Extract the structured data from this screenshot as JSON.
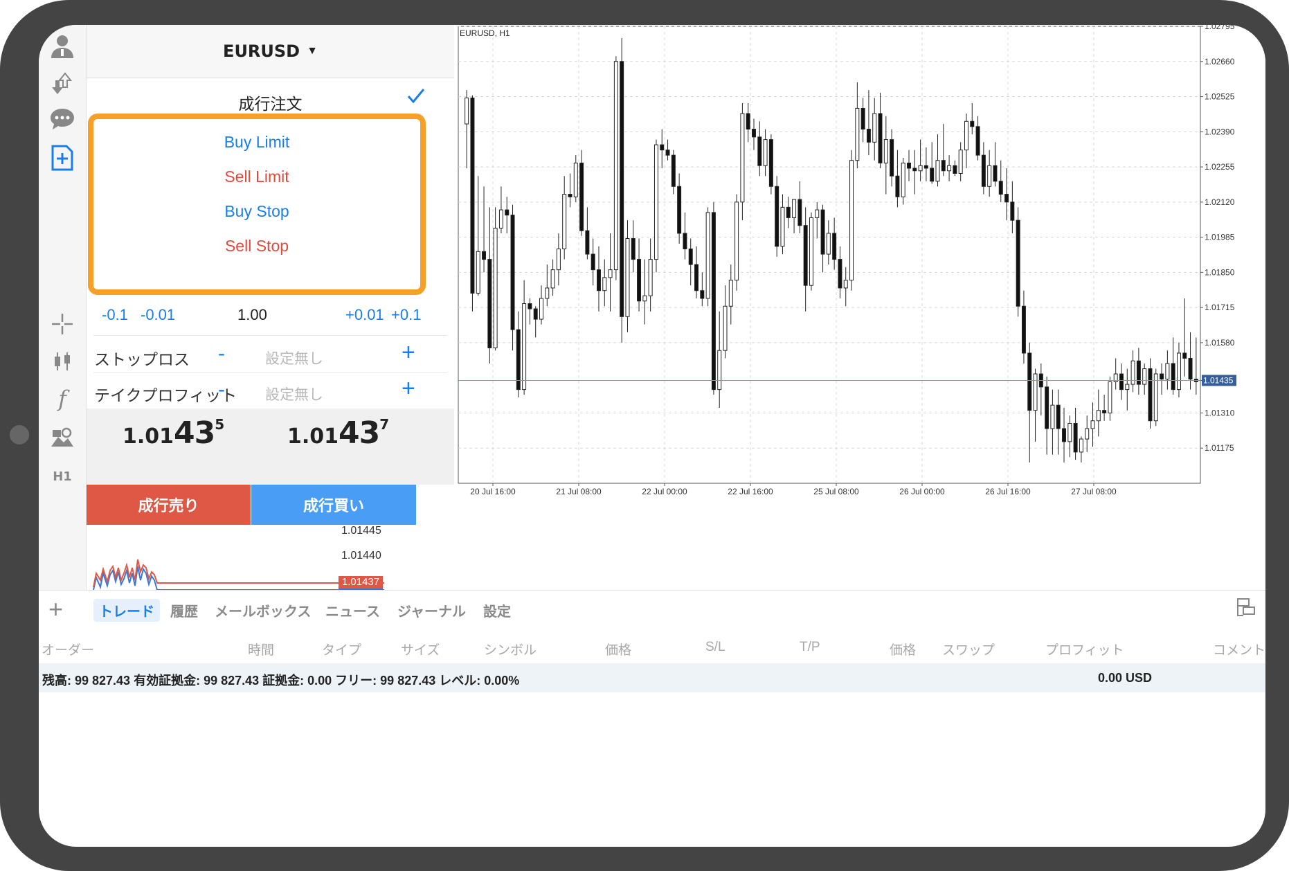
{
  "symbol": {
    "name": "EURUSD",
    "dropdown_arrow": "▼"
  },
  "order_types": {
    "selected": "成行注文",
    "options": [
      {
        "label": "Buy Limit",
        "color": "#1a7ee8"
      },
      {
        "label": "Sell Limit",
        "color": "#e04b3c"
      },
      {
        "label": "Buy Stop",
        "color": "#1a7ee8"
      },
      {
        "label": "Sell Stop",
        "color": "#e04b3c"
      }
    ]
  },
  "volume": {
    "dec_big": "-0.1",
    "dec_small": "-0.01",
    "value": "1.00",
    "inc_small": "+0.01",
    "inc_big": "+0.1"
  },
  "stop_loss": {
    "label": "ストップロス",
    "value": "設定無し",
    "minus": "-",
    "plus": "+"
  },
  "take_profit": {
    "label": "テイクプロフィット",
    "value": "設定無し",
    "minus": "-",
    "plus": "+"
  },
  "bid": {
    "p1": "1.01",
    "p2": "43",
    "p3": "5"
  },
  "ask": {
    "p1": "1.01",
    "p2": "43",
    "p3": "7"
  },
  "sell_button": "成行売り",
  "buy_button": "成行買い",
  "mini_chart": {
    "levels": [
      "1.01445",
      "1.01440"
    ],
    "last_price": "1.01437",
    "bid_tag": "1.01435"
  },
  "rail": {
    "timeframe": "H1"
  },
  "tabs": [
    "トレード",
    "履歴",
    "メールボックス",
    "ニュース",
    "ジャーナル",
    "設定"
  ],
  "columns": [
    "オーダー",
    "時間",
    "タイプ",
    "サイズ",
    "シンボル",
    "価格",
    "S/L",
    "T/P",
    "価格",
    "スワップ",
    "プロフィット",
    "コメント"
  ],
  "balance_line": "残高: 99 827.43 有効証拠金: 99 827.43 証拠金: 0.00 フリー: 99 827.43 レベル: 0.00%",
  "balance_total": "0.00  USD",
  "chart_data": {
    "type": "candlestick",
    "title": "EURUSD, H1",
    "y_ticks": [
      1.02795,
      1.0266,
      1.02525,
      1.0239,
      1.02255,
      1.0212,
      1.01985,
      1.0185,
      1.01715,
      1.0158,
      1.01435,
      1.0131,
      1.01175
    ],
    "y_tick_labels": [
      "1.02795",
      "1.02660",
      "1.02525",
      "1.02390",
      "1.02255",
      "1.02120",
      "1.01985",
      "1.01850",
      "1.01715",
      "1.01580",
      "1.01435",
      "1.01310",
      "1.01175"
    ],
    "ylim": [
      1.0104,
      1.02795
    ],
    "x_labels": [
      "20 Jul 16:00",
      "21 Jul 08:00",
      "22 Jul 00:00",
      "22 Jul 16:00",
      "25 Jul 08:00",
      "26 Jul 00:00",
      "26 Jul 16:00",
      "27 Jul 08:00"
    ],
    "current_price": 1.01435,
    "current_price_label": "1.01435",
    "grid": true,
    "candles": [
      [
        1.0242,
        1.0255,
        1.0225,
        1.0252
      ],
      [
        1.0252,
        1.0253,
        1.017,
        1.0177
      ],
      [
        1.0177,
        1.0222,
        1.0176,
        1.0193
      ],
      [
        1.0193,
        1.0218,
        1.0185,
        1.019
      ],
      [
        1.019,
        1.021,
        1.015,
        1.0156
      ],
      [
        1.0156,
        1.021,
        1.0155,
        1.0202
      ],
      [
        1.0202,
        1.0218,
        1.02,
        1.0209
      ],
      [
        1.0209,
        1.0214,
        1.02,
        1.0207
      ],
      [
        1.0207,
        1.0211,
        1.0155,
        1.0163
      ],
      [
        1.0163,
        1.017,
        1.0137,
        1.014
      ],
      [
        1.014,
        1.0182,
        1.0138,
        1.0173
      ],
      [
        1.0173,
        1.0175,
        1.0165,
        1.0171
      ],
      [
        1.0171,
        1.0172,
        1.016,
        1.0167
      ],
      [
        1.0167,
        1.018,
        1.0165,
        1.0175
      ],
      [
        1.0175,
        1.0188,
        1.0172,
        1.0179
      ],
      [
        1.0179,
        1.019,
        1.0176,
        1.0186
      ],
      [
        1.0186,
        1.02,
        1.018,
        1.0194
      ],
      [
        1.0194,
        1.0222,
        1.019,
        1.0215
      ],
      [
        1.0215,
        1.0223,
        1.021,
        1.0214
      ],
      [
        1.0214,
        1.023,
        1.0212,
        1.0227
      ],
      [
        1.0227,
        1.0232,
        1.0199,
        1.0201
      ],
      [
        1.0201,
        1.021,
        1.019,
        1.0192
      ],
      [
        1.0192,
        1.0198,
        1.018,
        1.0186
      ],
      [
        1.0186,
        1.0195,
        1.017,
        1.0178
      ],
      [
        1.0178,
        1.019,
        1.0172,
        1.0183
      ],
      [
        1.0183,
        1.02,
        1.017,
        1.0186
      ],
      [
        1.0186,
        1.0268,
        1.0182,
        1.0266
      ],
      [
        1.0266,
        1.0275,
        1.0158,
        1.0168
      ],
      [
        1.0168,
        1.0205,
        1.0162,
        1.0198
      ],
      [
        1.0198,
        1.0205,
        1.0185,
        1.019
      ],
      [
        1.019,
        1.0198,
        1.017,
        1.0174
      ],
      [
        1.0174,
        1.019,
        1.0165,
        1.0176
      ],
      [
        1.0176,
        1.0198,
        1.017,
        1.019
      ],
      [
        1.019,
        1.0236,
        1.0185,
        1.0234
      ],
      [
        1.0234,
        1.024,
        1.0225,
        1.0232
      ],
      [
        1.0232,
        1.0236,
        1.0228,
        1.023
      ],
      [
        1.023,
        1.0232,
        1.0215,
        1.0218
      ],
      [
        1.0218,
        1.0223,
        1.0196,
        1.02
      ],
      [
        1.02,
        1.0208,
        1.019,
        1.0194
      ],
      [
        1.0194,
        1.0198,
        1.018,
        1.0188
      ],
      [
        1.0188,
        1.0195,
        1.0175,
        1.0178
      ],
      [
        1.0178,
        1.0185,
        1.0172,
        1.0175
      ],
      [
        1.0175,
        1.021,
        1.0172,
        1.0208
      ],
      [
        1.0208,
        1.0212,
        1.0138,
        1.014
      ],
      [
        1.014,
        1.017,
        1.0133,
        1.0155
      ],
      [
        1.0155,
        1.018,
        1.0152,
        1.0172
      ],
      [
        1.0172,
        1.0188,
        1.0165,
        1.0182
      ],
      [
        1.0182,
        1.0215,
        1.0178,
        1.0212
      ],
      [
        1.0212,
        1.025,
        1.0205,
        1.0246
      ],
      [
        1.0246,
        1.025,
        1.0235,
        1.024
      ],
      [
        1.024,
        1.0244,
        1.0232,
        1.0237
      ],
      [
        1.0237,
        1.0243,
        1.0222,
        1.0226
      ],
      [
        1.0226,
        1.024,
        1.0222,
        1.0236
      ],
      [
        1.0236,
        1.0238,
        1.0215,
        1.0218
      ],
      [
        1.0218,
        1.0222,
        1.0191,
        1.0195
      ],
      [
        1.0195,
        1.0215,
        1.0192,
        1.021
      ],
      [
        1.021,
        1.0214,
        1.0202,
        1.0206
      ],
      [
        1.0206,
        1.0213,
        1.02,
        1.0213
      ],
      [
        1.0213,
        1.022,
        1.02,
        1.0203
      ],
      [
        1.0203,
        1.021,
        1.017,
        1.018
      ],
      [
        1.018,
        1.0208,
        1.0178,
        1.0206
      ],
      [
        1.0206,
        1.0212,
        1.0198,
        1.0209
      ],
      [
        1.0209,
        1.0211,
        1.0185,
        1.0192
      ],
      [
        1.0192,
        1.0205,
        1.0188,
        1.02
      ],
      [
        1.02,
        1.0206,
        1.0186,
        1.019
      ],
      [
        1.019,
        1.0195,
        1.0175,
        1.0179
      ],
      [
        1.0179,
        1.0187,
        1.0172,
        1.0182
      ],
      [
        1.0182,
        1.0232,
        1.0178,
        1.0228
      ],
      [
        1.0228,
        1.0258,
        1.0225,
        1.0248
      ],
      [
        1.0248,
        1.0252,
        1.0235,
        1.024
      ],
      [
        1.024,
        1.0255,
        1.023,
        1.0235
      ],
      [
        1.0235,
        1.0252,
        1.0228,
        1.0246
      ],
      [
        1.0246,
        1.0254,
        1.0225,
        1.0227
      ],
      [
        1.0227,
        1.0245,
        1.0215,
        1.0236
      ],
      [
        1.0236,
        1.024,
        1.0218,
        1.0222
      ],
      [
        1.0222,
        1.0232,
        1.021,
        1.0214
      ],
      [
        1.0214,
        1.0229,
        1.0211,
        1.0227
      ],
      [
        1.0227,
        1.0232,
        1.022,
        1.0225
      ],
      [
        1.0225,
        1.0232,
        1.0215,
        1.0224
      ],
      [
        1.0224,
        1.0236,
        1.022,
        1.0226
      ],
      [
        1.0226,
        1.0233,
        1.022,
        1.0225
      ],
      [
        1.0225,
        1.0235,
        1.0219,
        1.022
      ],
      [
        1.022,
        1.0238,
        1.0218,
        1.0228
      ],
      [
        1.0228,
        1.0242,
        1.0222,
        1.0224
      ],
      [
        1.0224,
        1.023,
        1.022,
        1.0226
      ],
      [
        1.0226,
        1.0228,
        1.0222,
        1.0223
      ],
      [
        1.0223,
        1.0235,
        1.022,
        1.0232
      ],
      [
        1.0232,
        1.0246,
        1.0225,
        1.0243
      ],
      [
        1.0243,
        1.025,
        1.0238,
        1.0241
      ],
      [
        1.0241,
        1.0245,
        1.0228,
        1.023
      ],
      [
        1.023,
        1.0235,
        1.0215,
        1.0218
      ],
      [
        1.0218,
        1.0232,
        1.0214,
        1.0226
      ],
      [
        1.0226,
        1.0235,
        1.0218,
        1.022
      ],
      [
        1.022,
        1.0228,
        1.0212,
        1.0215
      ],
      [
        1.0215,
        1.0225,
        1.0205,
        1.0212
      ],
      [
        1.0212,
        1.022,
        1.02,
        1.0205
      ],
      [
        1.0205,
        1.021,
        1.0168,
        1.0172
      ],
      [
        1.0172,
        1.0178,
        1.015,
        1.0154
      ],
      [
        1.0154,
        1.0158,
        1.0112,
        1.0132
      ],
      [
        1.0132,
        1.0148,
        1.012,
        1.0146
      ],
      [
        1.0146,
        1.015,
        1.013,
        1.0141
      ],
      [
        1.0141,
        1.0145,
        1.0115,
        1.0125
      ],
      [
        1.0125,
        1.014,
        1.0115,
        1.0134
      ],
      [
        1.0134,
        1.014,
        1.0115,
        1.0125
      ],
      [
        1.0125,
        1.0133,
        1.0112,
        1.012
      ],
      [
        1.012,
        1.013,
        1.0114,
        1.0127
      ],
      [
        1.0127,
        1.0133,
        1.0113,
        1.0116
      ],
      [
        1.0116,
        1.0122,
        1.0112,
        1.0121
      ],
      [
        1.0121,
        1.013,
        1.0116,
        1.0125
      ],
      [
        1.0125,
        1.0135,
        1.0118,
        1.0128
      ],
      [
        1.0128,
        1.014,
        1.0122,
        1.0132
      ],
      [
        1.0132,
        1.0138,
        1.0128,
        1.0131
      ],
      [
        1.0131,
        1.0145,
        1.0128,
        1.0143
      ],
      [
        1.0143,
        1.0152,
        1.014,
        1.0146
      ],
      [
        1.0146,
        1.015,
        1.0136,
        1.014
      ],
      [
        1.014,
        1.0148,
        1.0132,
        1.0142
      ],
      [
        1.0142,
        1.0155,
        1.0139,
        1.0151
      ],
      [
        1.0151,
        1.0156,
        1.0138,
        1.0142
      ],
      [
        1.0142,
        1.015,
        1.0138,
        1.0148
      ],
      [
        1.0148,
        1.0152,
        1.0125,
        1.0128
      ],
      [
        1.0128,
        1.0148,
        1.0126,
        1.0146
      ],
      [
        1.0146,
        1.015,
        1.0138,
        1.0144
      ],
      [
        1.0144,
        1.0155,
        1.014,
        1.015
      ],
      [
        1.015,
        1.016,
        1.0138,
        1.014
      ],
      [
        1.014,
        1.0158,
        1.0137,
        1.0154
      ],
      [
        1.0154,
        1.0175,
        1.0145,
        1.0152
      ],
      [
        1.0152,
        1.0162,
        1.014,
        1.0144
      ],
      [
        1.0144,
        1.016,
        1.0138,
        1.0143
      ]
    ]
  },
  "colors": {
    "accent": "#1a7ee8",
    "sell": "#df5845",
    "buy": "#4a9df5",
    "highlight": "#f5a028",
    "frame": "#444444"
  }
}
